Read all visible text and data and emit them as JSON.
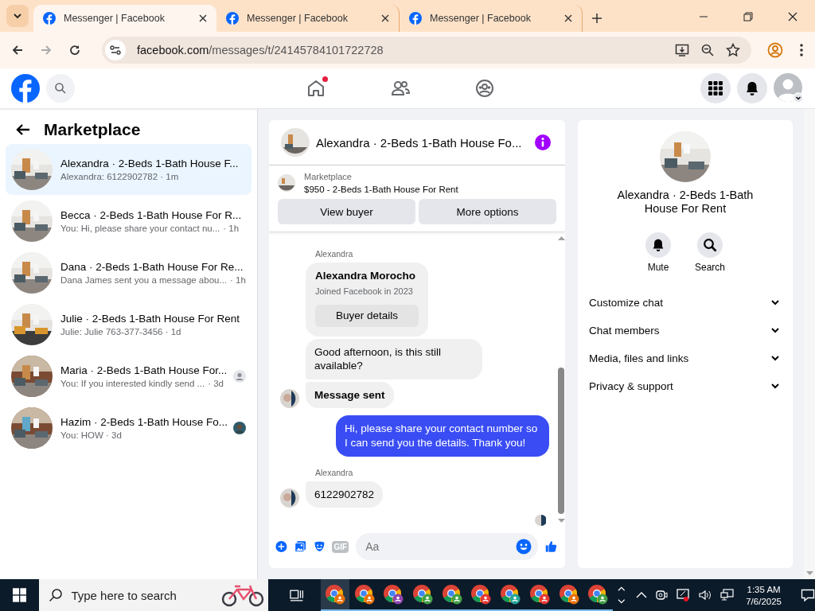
{
  "browser": {
    "tabs": [
      {
        "title": "Messenger | Facebook",
        "selected": true
      },
      {
        "title": "Messenger | Facebook",
        "selected": false
      },
      {
        "title": "Messenger | Facebook",
        "selected": false
      }
    ],
    "url_host": "facebook.com",
    "url_path": "/messages/t/24145784101722728"
  },
  "top_nav": {
    "home_notification": true
  },
  "sidebar": {
    "title": "Marketplace",
    "conversations": [
      {
        "title": "Alexandra · 2-Beds 1-Bath House F...",
        "preview": "Alexandra: 6122902782 · 1m",
        "selected": true
      },
      {
        "title": "Becca · 2-Beds 1-Bath House For R...",
        "preview": "You: Hi, please share your contact nu...",
        "time": "· 1h",
        "selected": false
      },
      {
        "title": "Dana · 2-Beds 1-Bath House For Re...",
        "preview": "Dana James sent you a message abou...",
        "time": "· 1h",
        "selected": false
      },
      {
        "title": "Julie · 2-Beds 1-Bath House For Rent",
        "preview": "Julie: Julie 763-377-3456 · 1d",
        "selected": false
      },
      {
        "title": "Maria · 2-Beds 1-Bath House For...",
        "preview": "You: If you interested kindly send ...",
        "time": "· 3d",
        "selected": false,
        "seen_marker": {
          "kind": "icon"
        }
      },
      {
        "title": "Hazim · 2-Beds 1-Bath House Fo...",
        "preview": "You: HOW · 3d",
        "selected": false
      }
    ]
  },
  "chat": {
    "title": "Alexandra · 2-Beds 1-Bath House Fo...",
    "listing": {
      "label": "Marketplace",
      "title": "$950 - 2-Beds 1-Bath House For Rent"
    },
    "buttons": [
      "View buyer",
      "More options"
    ],
    "messages": [
      {
        "kind": "sender",
        "text": "Alexandra"
      },
      {
        "kind": "card",
        "name": "Alexandra Morocho",
        "subtitle": "Joined Facebook in 2023",
        "button": "Buyer details"
      },
      {
        "kind": "incoming",
        "text": "Good afternoon, is this still available?",
        "avatar": false,
        "bold": false
      },
      {
        "kind": "incoming",
        "text": "Message sent",
        "avatar": true,
        "bold": true
      },
      {
        "kind": "outgoing",
        "text": "Hi, please share your contact number so I can send you the details. Thank you!"
      },
      {
        "kind": "sender",
        "text": "Alexandra"
      },
      {
        "kind": "incoming",
        "text": "6122902782",
        "avatar": true,
        "bold": false
      }
    ],
    "composer": {
      "placeholder": "Aa",
      "gif_label": "GIF"
    }
  },
  "details": {
    "title": "Alexandra · 2-Beds 1-Bath House For Rent",
    "actions": [
      {
        "kind": "mute",
        "label": "Mute"
      },
      {
        "kind": "search",
        "label": "Search"
      }
    ],
    "sections": [
      {
        "label": "Customize chat",
        "expanded": false
      },
      {
        "label": "Chat members",
        "expanded": false
      },
      {
        "label": "Media, files and links",
        "expanded": false
      },
      {
        "label": "Privacy & support",
        "expanded": false
      }
    ]
  },
  "taskbar": {
    "search_placeholder": "Type here to search",
    "apps": [
      {
        "color": "#e8710a",
        "selected": true
      },
      {
        "color": "#e8710a",
        "selected": false
      },
      {
        "color": "#8e44ad",
        "selected": false
      },
      {
        "color": "#43a047",
        "selected": false
      },
      {
        "color": "#43a047",
        "selected": false
      },
      {
        "color": "#e53935",
        "selected": false
      },
      {
        "color": "#26a69a",
        "selected": false
      },
      {
        "color": "#e53935",
        "selected": false
      },
      {
        "color": "#e8710a",
        "selected": false
      },
      {
        "color": "#43a047",
        "selected": false
      }
    ],
    "time": "1:35 AM",
    "date": "7/6/2025"
  }
}
